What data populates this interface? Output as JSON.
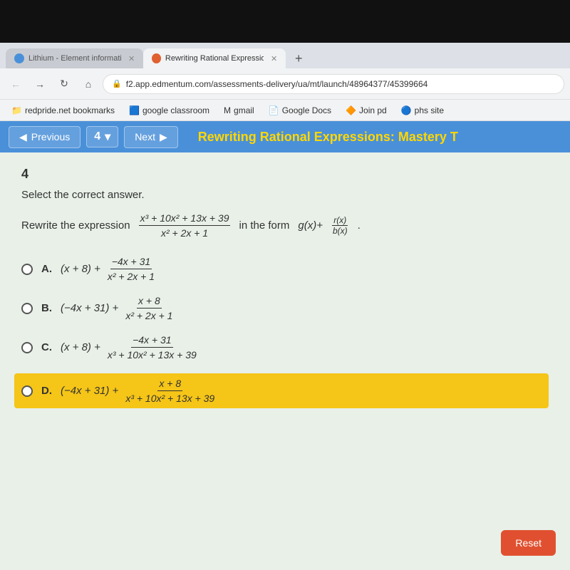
{
  "browser": {
    "tabs": [
      {
        "id": "tab1",
        "label": "Lithium - Element information, p...",
        "icon_color": "#4a90d9",
        "active": false
      },
      {
        "id": "tab2",
        "label": "Rewriting Rational Expressions",
        "icon_color": "#e06030",
        "active": true
      }
    ],
    "new_tab_label": "+",
    "nav": {
      "back_icon": "←",
      "forward_icon": "→",
      "refresh_icon": "↻",
      "home_icon": "⌂",
      "url": "f2.app.edmentum.com/assessments-delivery/ua/mt/launch/48964377/45399664",
      "lock_icon": "🔒"
    },
    "bookmarks": [
      {
        "label": "redpride.net bookmarks",
        "icon": "📁"
      },
      {
        "label": "google classroom",
        "icon": "🟦"
      },
      {
        "label": "gmail",
        "icon": "📧"
      },
      {
        "label": "Google Docs",
        "icon": "📄"
      },
      {
        "label": "Join pd",
        "icon": "🔶"
      },
      {
        "label": "phs site",
        "icon": "🔵"
      }
    ]
  },
  "toolbar": {
    "prev_label": "Previous",
    "prev_icon": "◀",
    "question_num": "4",
    "dropdown_icon": "▾",
    "next_label": "Next",
    "next_icon": "▶",
    "title": "Rewriting Rational Expressions: Mastery T"
  },
  "question": {
    "number": "4",
    "instruction": "Select the correct answer.",
    "prompt_start": "Rewrite the expression",
    "main_fraction": {
      "numerator": "x³ + 10x² + 13x + 39",
      "denominator": "x² + 2x + 1"
    },
    "prompt_end": "in the form",
    "form_text": "g(x)+",
    "form_fraction": {
      "numerator": "r(x)",
      "denominator": "b(x)"
    },
    "choices": [
      {
        "id": "A",
        "label": "A.",
        "expr_main": "(x + 8) +",
        "fraction": {
          "numerator": "−4x + 31",
          "denominator": "x² + 2x + 1"
        },
        "selected": false
      },
      {
        "id": "B",
        "label": "B.",
        "expr_main": "(−4x + 31) +",
        "fraction": {
          "numerator": "x + 8",
          "denominator": "x² + 2x + 1"
        },
        "selected": false
      },
      {
        "id": "C",
        "label": "C.",
        "expr_main": "(x + 8) +",
        "fraction": {
          "numerator": "−4x + 31",
          "denominator": "x³ + 10x² + 13x + 39"
        },
        "selected": false
      },
      {
        "id": "D",
        "label": "D.",
        "expr_main": "(−4x + 31) +",
        "fraction": {
          "numerator": "x + 8",
          "denominator": "x³ + 10x² + 13x + 39"
        },
        "selected": true
      }
    ],
    "reset_label": "Reset"
  }
}
